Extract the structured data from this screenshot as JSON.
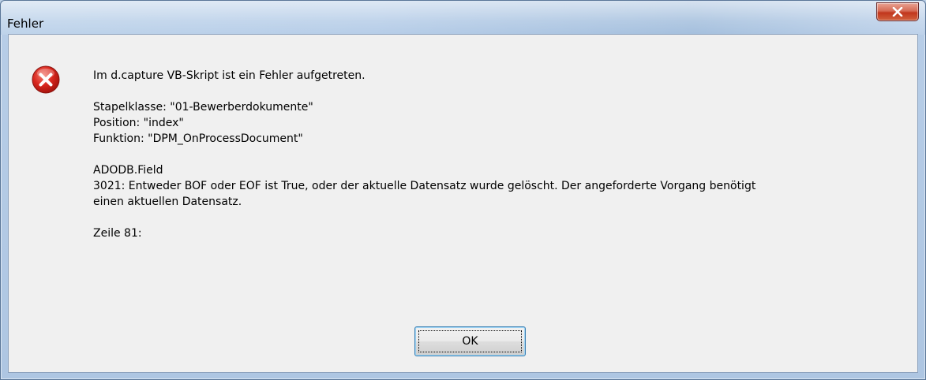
{
  "window": {
    "title": "Fehler",
    "close_label": "X"
  },
  "message": {
    "icon": "error-icon",
    "headline": "Im d.capture VB-Skript ist ein Fehler aufgetreten.",
    "batch_class": "Stapelklasse: \"01-Bewerberdokumente\"",
    "position": "Position: \"index\"",
    "function": "Funktion: \"DPM_OnProcessDocument\"",
    "source": "ADODB.Field",
    "error_line1": "3021: Entweder BOF oder EOF ist True, oder der aktuelle Datensatz wurde gelöscht. Der angeforderte Vorgang benötigt",
    "error_line2": "einen aktuellen Datensatz.",
    "line_info": "Zeile 81:"
  },
  "buttons": {
    "ok_label": "OK"
  },
  "colors": {
    "dialog_bg": "#f0f0f0",
    "error_red": "#c8201a",
    "close_red": "#c1361d"
  }
}
